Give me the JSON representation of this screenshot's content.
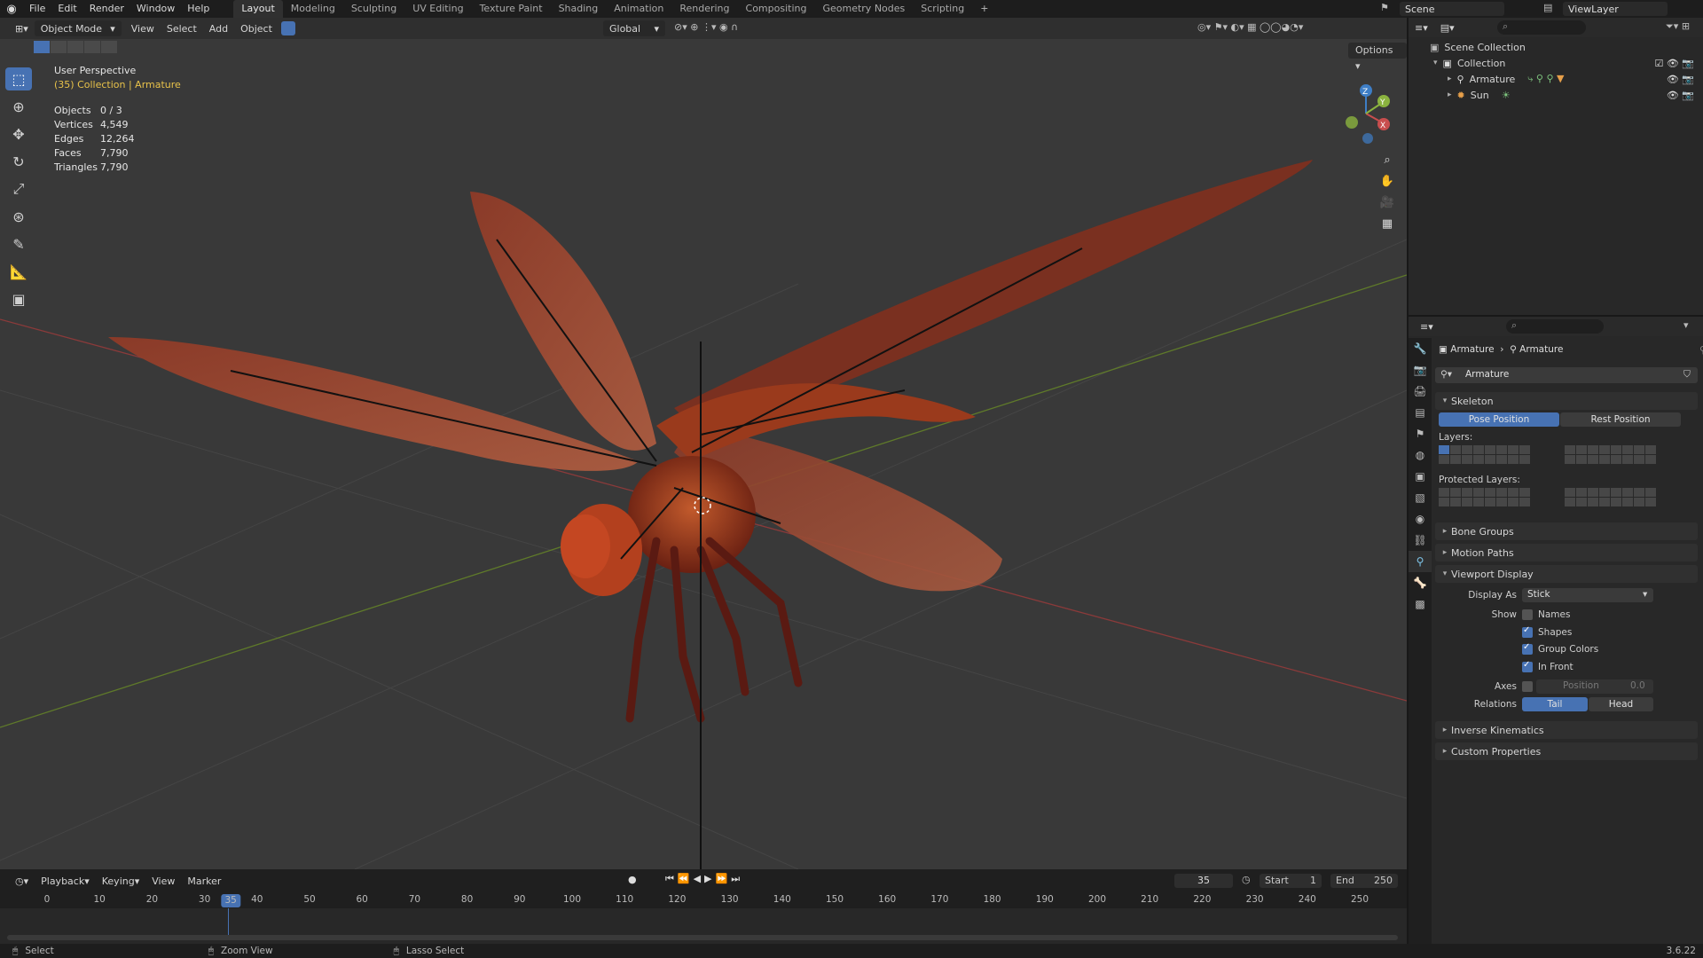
{
  "topbar": {
    "menus": [
      "File",
      "Edit",
      "Render",
      "Window",
      "Help"
    ],
    "workspaces": [
      "Layout",
      "Modeling",
      "Sculpting",
      "UV Editing",
      "Texture Paint",
      "Shading",
      "Animation",
      "Rendering",
      "Compositing",
      "Geometry Nodes",
      "Scripting"
    ],
    "active_workspace": "Layout",
    "scene": "Scene",
    "view_layer": "ViewLayer"
  },
  "viewport_header": {
    "mode": "Object Mode",
    "menus": [
      "View",
      "Select",
      "Add",
      "Object"
    ],
    "orientation": "Global",
    "options": "Options"
  },
  "overlay": {
    "view_name": "User Perspective",
    "context": "(35) Collection | Armature"
  },
  "stats": [
    {
      "k": "Objects",
      "v": "0 / 3"
    },
    {
      "k": "Vertices",
      "v": "4,549"
    },
    {
      "k": "Edges",
      "v": "12,264"
    },
    {
      "k": "Faces",
      "v": "7,790"
    },
    {
      "k": "Triangles",
      "v": "7,790"
    }
  ],
  "gizmo": {
    "z": "Z",
    "x": "X",
    "y": "Y"
  },
  "timeline": {
    "menus": [
      "Playback",
      "Keying",
      "View",
      "Marker"
    ],
    "current_frame": "35",
    "start_label": "Start",
    "start": "1",
    "end_label": "End",
    "end": "250",
    "ruler": [
      "0",
      "10",
      "20",
      "30",
      "40",
      "50",
      "60",
      "70",
      "80",
      "90",
      "100",
      "110",
      "120",
      "130",
      "140",
      "150",
      "160",
      "170",
      "180",
      "190",
      "200",
      "210",
      "220",
      "230",
      "240",
      "250"
    ]
  },
  "statusbar": {
    "select": "Select",
    "zoom": "Zoom View",
    "lasso": "Lasso Select",
    "version": "3.6.22"
  },
  "outliner": {
    "scene_collection": "Scene Collection",
    "collection": "Collection",
    "items": [
      "Armature",
      "Sun"
    ]
  },
  "properties": {
    "breadcrumb_obj": "Armature",
    "breadcrumb_data": "Armature",
    "datablock": "Armature",
    "skeleton": "Skeleton",
    "pose_position": "Pose Position",
    "rest_position": "Rest Position",
    "layers_label": "Layers:",
    "protected_layers_label": "Protected Layers:",
    "bone_groups": "Bone Groups",
    "motion_paths": "Motion Paths",
    "viewport_display": "Viewport Display",
    "display_as_label": "Display As",
    "display_as": "Stick",
    "show_label": "Show",
    "names": "Names",
    "shapes": "Shapes",
    "group_colors": "Group Colors",
    "in_front": "In Front",
    "axes_label": "Axes",
    "position_label": "Position",
    "position_value": "0.0",
    "relations_label": "Relations",
    "tail": "Tail",
    "head": "Head",
    "inverse_kinematics": "Inverse Kinematics",
    "custom_properties": "Custom Properties"
  },
  "colors": {
    "accent": "#4772b3",
    "context_yellow": "#e8c24a",
    "axis_x": "#c84e4e",
    "axis_y": "#8bb33f",
    "axis_z": "#3e7ec6"
  }
}
